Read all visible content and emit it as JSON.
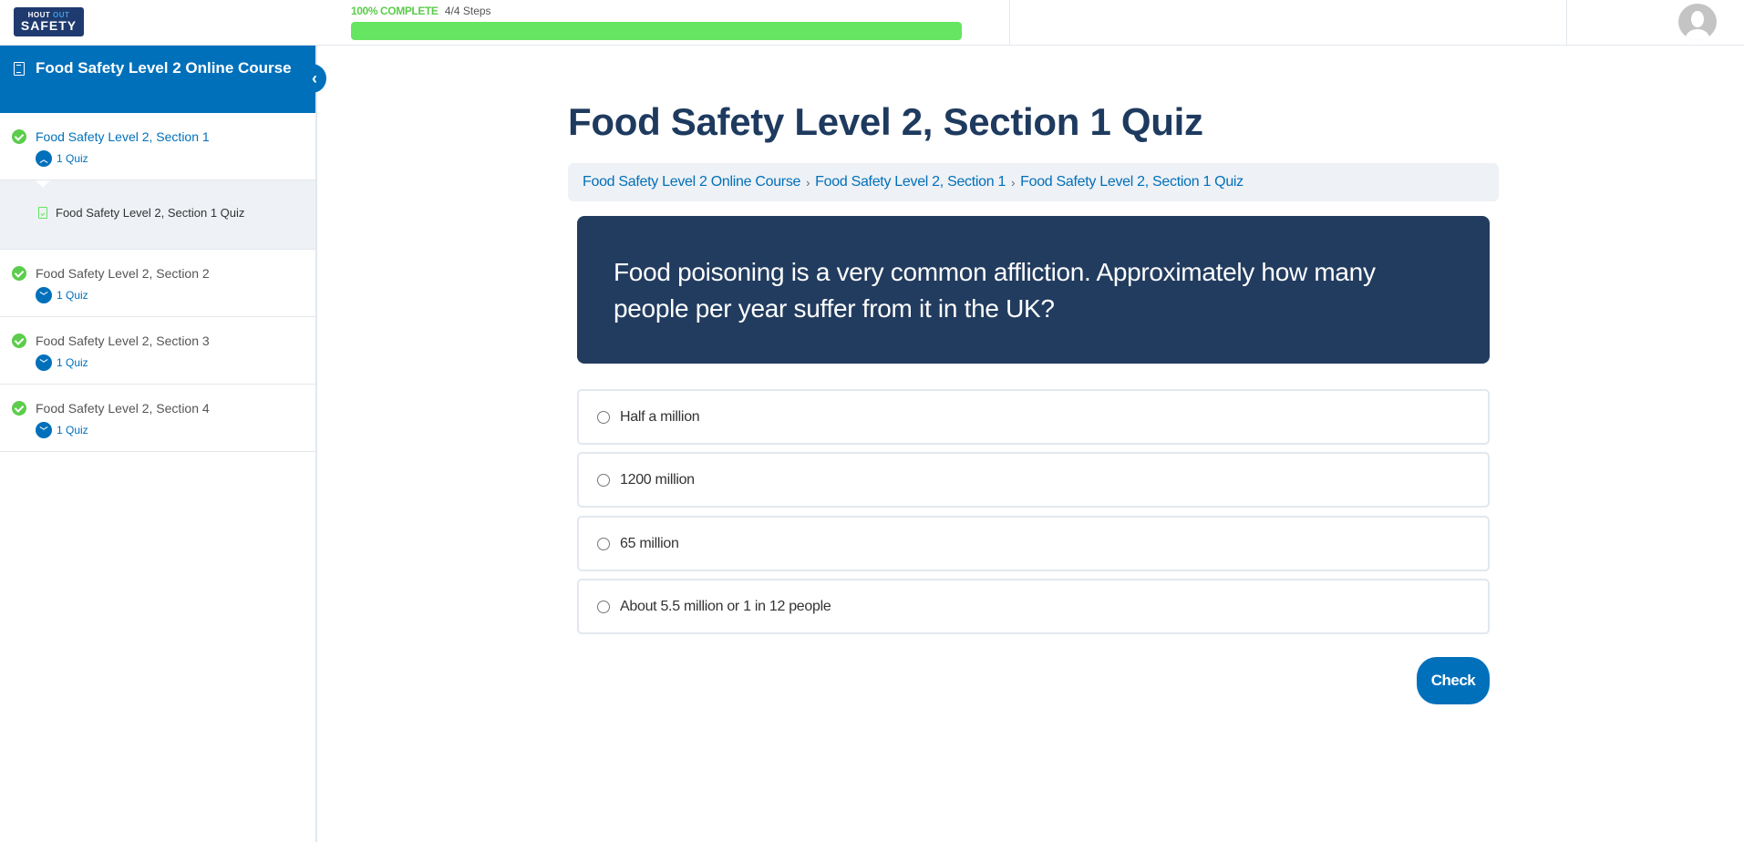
{
  "header": {
    "logo": {
      "line1_a": "HOUT",
      "line1_b": "OUT",
      "line2": "SAFETY"
    },
    "progress": {
      "label": "100% COMPLETE",
      "steps": "4/4 Steps",
      "percent": 100
    },
    "avatar_icon": "user-avatar-icon"
  },
  "sidebar": {
    "course_title": "Food Safety Level 2 Online Course",
    "sections": [
      {
        "title": "Food Safety Level 2, Section 1",
        "toggle_label": "1 Quiz",
        "expanded": true,
        "status": "complete"
      },
      {
        "title": "Food Safety Level 2, Section 2",
        "toggle_label": "1 Quiz",
        "expanded": false,
        "status": "complete"
      },
      {
        "title": "Food Safety Level 2, Section 3",
        "toggle_label": "1 Quiz",
        "expanded": false,
        "status": "complete"
      },
      {
        "title": "Food Safety Level 2, Section 4",
        "toggle_label": "1 Quiz",
        "expanded": false,
        "status": "complete"
      }
    ],
    "sub_item": "Food Safety Level 2, Section 1 Quiz"
  },
  "main": {
    "title": "Food Safety Level 2, Section 1 Quiz",
    "breadcrumb": [
      "Food Safety Level 2 Online Course",
      "Food Safety Level 2, Section 1",
      "Food Safety Level 2, Section 1 Quiz"
    ],
    "breadcrumb_separator": "›",
    "question": "Food poisoning is a very common affliction. Approximately how many people per year suffer from it in the UK?",
    "answers": [
      "Half a million",
      "1200 million",
      "65 million",
      "About 5.5 million or 1 in 12 people"
    ],
    "check_label": "Check"
  },
  "colors": {
    "brand_blue": "#0070bb",
    "dark_navy": "#223c5f",
    "success_green": "#65e561"
  }
}
